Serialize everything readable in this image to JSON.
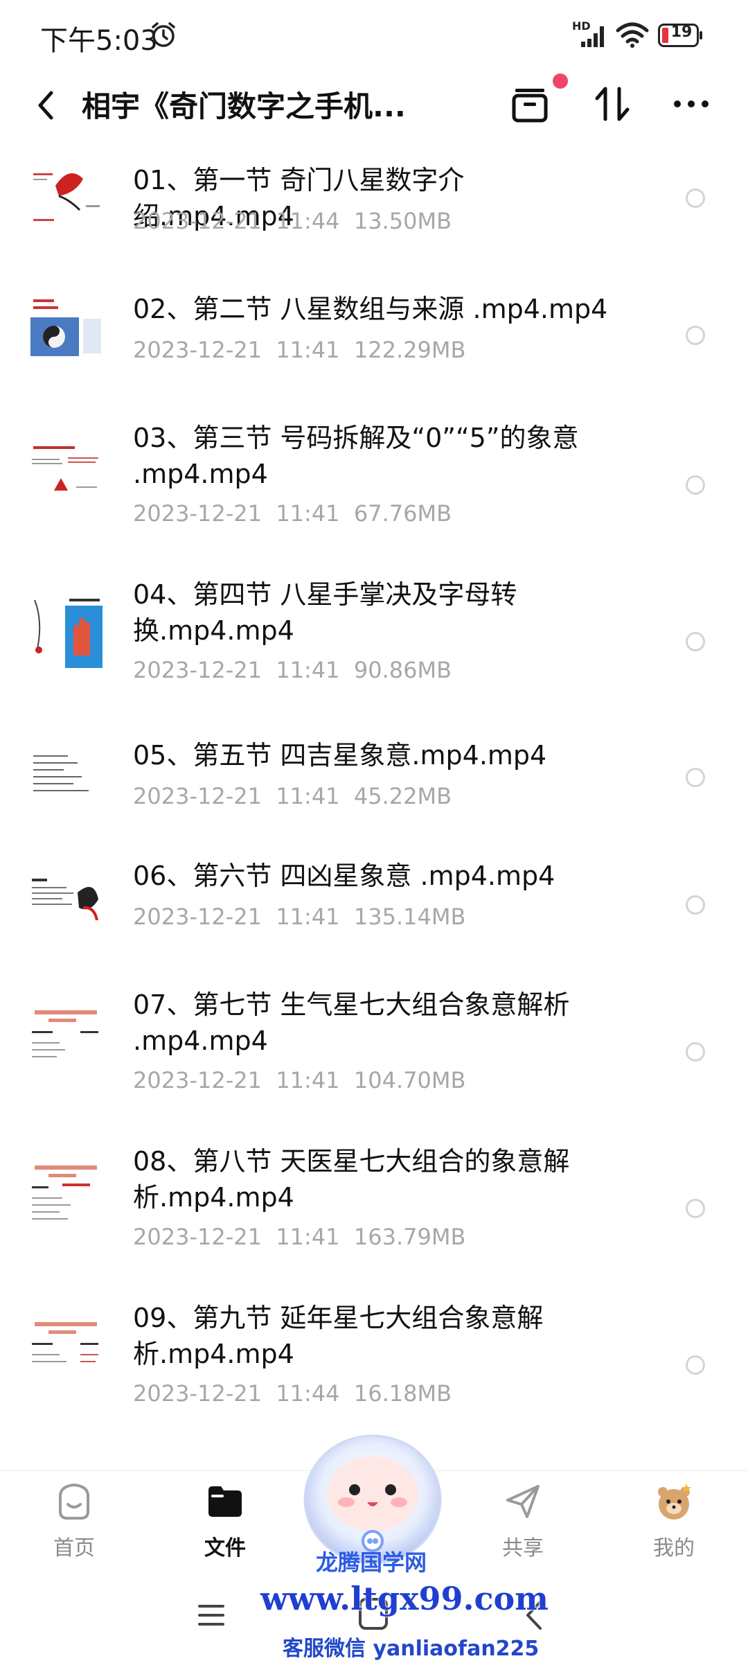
{
  "status_bar": {
    "time": "下午5:03",
    "network_label": "HD",
    "battery": "19"
  },
  "header": {
    "title": "相宇《奇门数字之手机..."
  },
  "files": [
    {
      "title": "01、第一节 奇门八星数字介绍.mp4.mp4",
      "date": "2023-12-21",
      "time": "11:44",
      "size": "13.50MB"
    },
    {
      "title": "02、第二节 八星数组与来源 .mp4.mp4",
      "date": "2023-12-21",
      "time": "11:41",
      "size": "122.29MB"
    },
    {
      "title": "03、第三节 号码拆解及“0”“5”的象意 .mp4.mp4",
      "date": "2023-12-21",
      "time": "11:41",
      "size": "67.76MB"
    },
    {
      "title": "04、第四节 八星手掌决及字母转换.mp4.mp4",
      "date": "2023-12-21",
      "time": "11:41",
      "size": "90.86MB"
    },
    {
      "title": "05、第五节 四吉星象意.mp4.mp4",
      "date": "2023-12-21",
      "time": "11:41",
      "size": "45.22MB"
    },
    {
      "title": "06、第六节 四凶星象意 .mp4.mp4",
      "date": "2023-12-21",
      "time": "11:41",
      "size": "135.14MB"
    },
    {
      "title": "07、第七节 生气星七大组合象意解析 .mp4.mp4",
      "date": "2023-12-21",
      "time": "11:41",
      "size": "104.70MB"
    },
    {
      "title": "08、第八节 天医星七大组合的象意解析.mp4.mp4",
      "date": "2023-12-21",
      "time": "11:41",
      "size": "163.79MB"
    },
    {
      "title": "09、第九节 延年星七大组合象意解析.mp4.mp4",
      "date": "2023-12-21",
      "time": "11:44",
      "size": "16.18MB"
    }
  ],
  "bottom_nav": [
    {
      "label": "首页",
      "icon": "home-icon",
      "active": false
    },
    {
      "label": "文件",
      "icon": "folder-icon",
      "active": true
    },
    {
      "label": "共享",
      "icon": "share-icon",
      "active": false
    },
    {
      "label": "我的",
      "icon": "avatar-icon",
      "active": false
    }
  ],
  "watermark": {
    "name": "龙腾国学网",
    "url": "www.ltgx99.com",
    "wechat": "客服微信 yanliaofan225"
  },
  "colors": {
    "accent_red": "#f0456b",
    "meta_gray": "#a7a7a7",
    "watermark_blue": "#1f3fd0"
  }
}
